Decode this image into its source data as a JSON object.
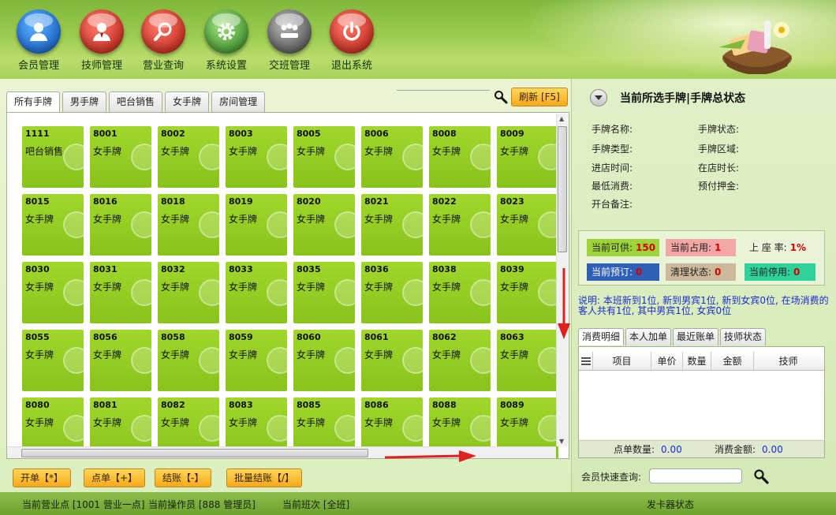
{
  "toolbar": {
    "buttons": [
      {
        "label": "会员管理",
        "icon": "member-icon"
      },
      {
        "label": "技师管理",
        "icon": "technician-icon"
      },
      {
        "label": "营业查询",
        "icon": "search-icon"
      },
      {
        "label": "系统设置",
        "icon": "gear-icon"
      },
      {
        "label": "交班管理",
        "icon": "handover-icon"
      },
      {
        "label": "退出系统",
        "icon": "power-icon"
      }
    ]
  },
  "tabs": [
    "所有手牌",
    "男手牌",
    "吧台销售",
    "女手牌",
    "房间管理"
  ],
  "refresh_label": "刷新 [F5]",
  "cards": [
    [
      "1111",
      "吧台销售"
    ],
    [
      "8001",
      "女手牌"
    ],
    [
      "8002",
      "女手牌"
    ],
    [
      "8003",
      "女手牌"
    ],
    [
      "8005",
      "女手牌"
    ],
    [
      "8006",
      "女手牌"
    ],
    [
      "8008",
      "女手牌"
    ],
    [
      "8009",
      "女手牌"
    ],
    [
      "8015",
      "女手牌"
    ],
    [
      "8016",
      "女手牌"
    ],
    [
      "8018",
      "女手牌"
    ],
    [
      "8019",
      "女手牌"
    ],
    [
      "8020",
      "女手牌"
    ],
    [
      "8021",
      "女手牌"
    ],
    [
      "8022",
      "女手牌"
    ],
    [
      "8023",
      "女手牌"
    ],
    [
      "8030",
      "女手牌"
    ],
    [
      "8031",
      "女手牌"
    ],
    [
      "8032",
      "女手牌"
    ],
    [
      "8033",
      "女手牌"
    ],
    [
      "8035",
      "女手牌"
    ],
    [
      "8036",
      "女手牌"
    ],
    [
      "8038",
      "女手牌"
    ],
    [
      "8039",
      "女手牌"
    ],
    [
      "8055",
      "女手牌"
    ],
    [
      "8056",
      "女手牌"
    ],
    [
      "8058",
      "女手牌"
    ],
    [
      "8059",
      "女手牌"
    ],
    [
      "8060",
      "女手牌"
    ],
    [
      "8061",
      "女手牌"
    ],
    [
      "8062",
      "女手牌"
    ],
    [
      "8063",
      "女手牌"
    ],
    [
      "8080",
      "女手牌"
    ],
    [
      "8081",
      "女手牌"
    ],
    [
      "8082",
      "女手牌"
    ],
    [
      "8083",
      "女手牌"
    ],
    [
      "8085",
      "女手牌"
    ],
    [
      "8086",
      "女手牌"
    ],
    [
      "8088",
      "女手牌"
    ],
    [
      "8089",
      "女手牌"
    ]
  ],
  "actions": [
    "开单【*】",
    "点单【+】",
    "结账【-】",
    "批量结账【/】"
  ],
  "right": {
    "title": "当前所选手牌|手牌总状态",
    "fields_left": [
      "手牌名称:",
      "手牌类型:",
      "进店时间:",
      "最低消费:",
      "开台备注:"
    ],
    "fields_right": [
      "手牌状态:",
      "手牌区域:",
      "在店时长:",
      "预付押金:"
    ],
    "stats": {
      "available_label": "当前可供:",
      "available": "150",
      "occupied_label": "当前占用:",
      "occupied": "1",
      "rate_label": "上 座 率:",
      "rate": "1%",
      "reserved_label": "当前预订:",
      "reserved": "0",
      "cleaning_label": "清理状态:",
      "cleaning": "0",
      "disabled_label": "当前停用:",
      "disabled": "0"
    },
    "note": "说明: 本班新到1位, 新到男宾1位, 新到女宾0位, 在场消费的客人共有1位, 其中男宾1位, 女宾0位",
    "detail_tabs": [
      "消费明细",
      "本人加单",
      "最近账单",
      "技师状态"
    ],
    "table_columns": [
      "项目",
      "单价",
      "数量",
      "金额",
      "技师"
    ],
    "footer_count_label": "点单数量:",
    "footer_count": "0.00",
    "footer_amount_label": "消费金额:",
    "footer_amount": "0.00",
    "member_query_label": "会员快速查询:",
    "member_query_value": ""
  },
  "status": {
    "business_point": "当前营业点 [1001 营业一点]",
    "operator": "当前操作员 [888 管理员]",
    "shift": "当前班次 [全班]",
    "card_reader": "发卡器状态"
  },
  "colors": {
    "card_green": "#92cb22",
    "button_orange": "#f8b52b",
    "note_blue": "#1a2bd0",
    "value_red": "#d30000"
  }
}
